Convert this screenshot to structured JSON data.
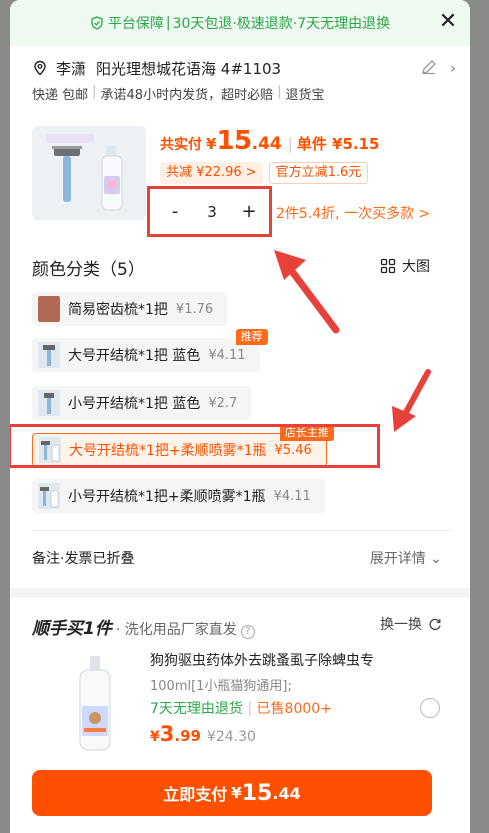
{
  "colors": {
    "accent": "#ff5000",
    "guarantee_green": "#2aa84a",
    "highlight_red": "#e8403a"
  },
  "banner": {
    "icon": "shield-check-icon",
    "items": [
      "平台保障",
      "30天包退·极速退款·7天无理由退换"
    ],
    "close_icon": "close-icon"
  },
  "address": {
    "icon": "location-pin-icon",
    "name": "李潇",
    "detail": "阳光理想城花语海 4#1103",
    "shipping": [
      "快递 包邮",
      "承诺48小时内发货，超时必赔",
      "退货宝"
    ]
  },
  "product": {
    "total_label": "共实付",
    "yen": "¥",
    "total_int": "15",
    "total_dec": ".44",
    "unit_label": "单件 ¥5.15",
    "saved_chip": "共减 ¥22.96 >",
    "official_chip": "官方立减1.6元",
    "minus": "-",
    "qty": "3",
    "plus": "+",
    "bulk_offer": "2件5.4折, 一次买多款 >"
  },
  "variants": {
    "title": "颜色分类（5）",
    "big_view": "大图",
    "items": [
      {
        "label": "简易密齿梳*1把",
        "price": "¥1.76",
        "tag": "",
        "selected": false
      },
      {
        "label": "大号开结梳*1把 蓝色",
        "price": "¥4.11",
        "tag": "推荐",
        "selected": false
      },
      {
        "label": "小号开结梳*1把 蓝色",
        "price": "¥2.7",
        "tag": "",
        "selected": false
      },
      {
        "label": "大号开结梳*1把+柔顺喷雾*1瓶",
        "price": "¥5.46",
        "tag": "店长主推",
        "selected": true
      },
      {
        "label": "小号开结梳*1把+柔顺喷雾*1瓶",
        "price": "¥4.11",
        "tag": "",
        "selected": false
      }
    ]
  },
  "remark": {
    "label": "备注·发票已折叠",
    "expand": "展开详情"
  },
  "shunshou": {
    "logo": "顺手买1件",
    "subtitle": "· 洗化用品厂家直发",
    "help": "?",
    "swap": "换一换",
    "title": "狗狗驱虫药体外去跳蚤虱子除蜱虫专",
    "spec": "100ml[1小瓶猫狗通用];",
    "promo_green": "7天无理由退货",
    "promo_sold": "已售8000+",
    "yen": "¥",
    "price_int": "3",
    "price_dec": ".99",
    "orig_price": "¥24.30"
  },
  "pay": {
    "label": "立即支付",
    "yen": "¥",
    "int": "15",
    "dec": ".44"
  }
}
